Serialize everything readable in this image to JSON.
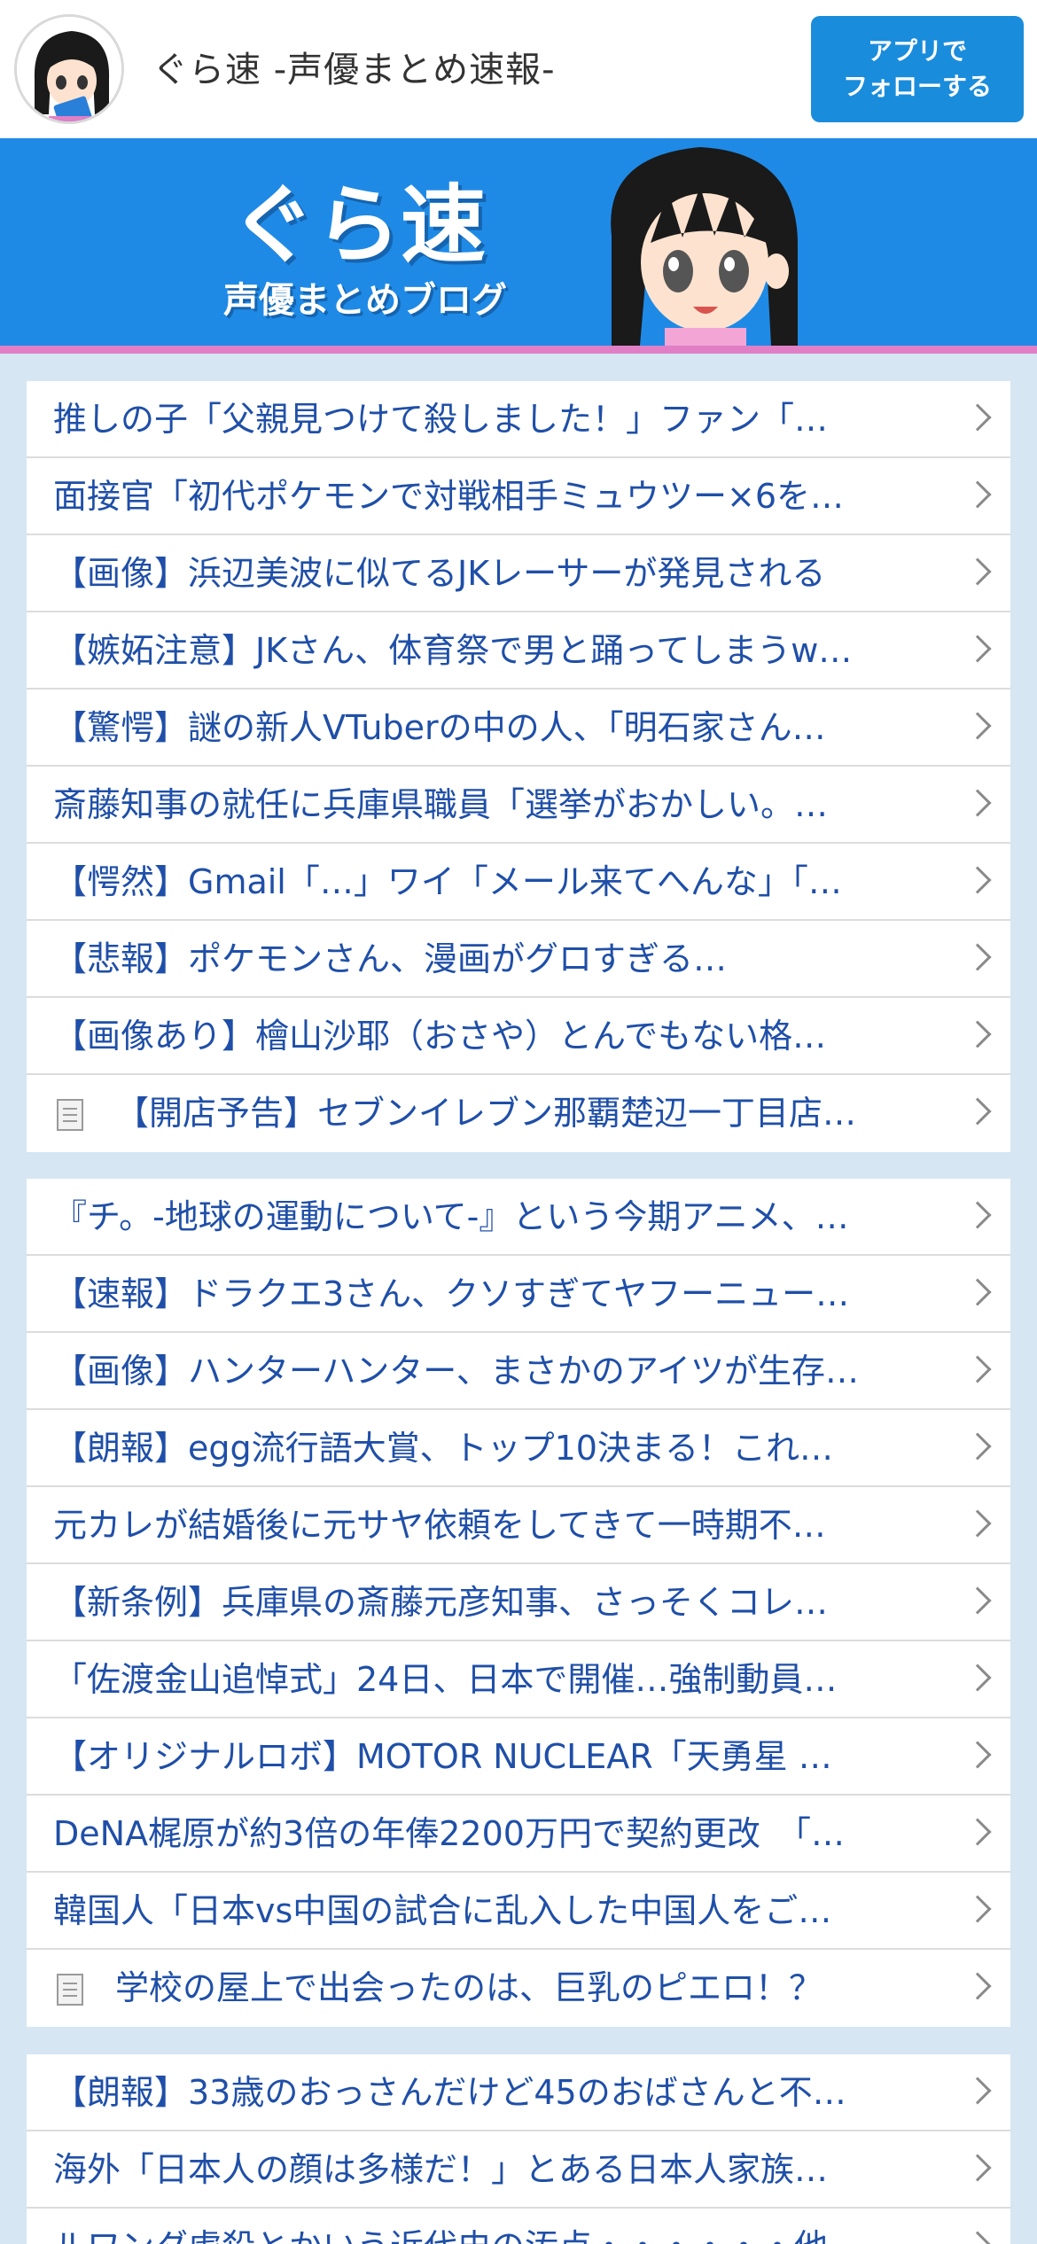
{
  "header": {
    "site_title": "ぐら速  -声優まとめ速報-",
    "follow_line1": "アプリで",
    "follow_line2": "フォローする"
  },
  "banner": {
    "logo_main": "ぐら速",
    "logo_sub": "声優まとめブログ"
  },
  "lists": [
    {
      "items": [
        {
          "text": "推しの子「父親見つけて殺しました！」ファン「…",
          "doc": false
        },
        {
          "text": "面接官「初代ポケモンで対戦相手ミュウツー×6を…",
          "doc": false
        },
        {
          "text": "【画像】浜辺美波に似てるJKレーサーが発見される",
          "doc": false
        },
        {
          "text": "【嫉妬注意】JKさん、体育祭で男と踊ってしまうw…",
          "doc": false
        },
        {
          "text": "【驚愕】謎の新人VTuberの中の人、「明石家さん…",
          "doc": false
        },
        {
          "text": "斎藤知事の就任に兵庫県職員「選挙がおかしい。…",
          "doc": false
        },
        {
          "text": "【愕然】Gmail「…」ワイ「メール来てへんな」「…",
          "doc": false
        },
        {
          "text": "【悲報】ポケモンさん、漫画がグロすぎる…",
          "doc": false
        },
        {
          "text": "【画像あり】檜山沙耶（おさや）とんでもない格…",
          "doc": false
        },
        {
          "text": "【開店予告】セブンイレブン那覇楚辺一丁目店…",
          "doc": true
        }
      ]
    },
    {
      "items": [
        {
          "text": "『チ。-地球の運動について-』という今期アニメ、…",
          "doc": false
        },
        {
          "text": "【速報】ドラクエ3さん、クソすぎてヤフーニュー…",
          "doc": false
        },
        {
          "text": "【画像】ハンターハンター、まさかのアイツが生存…",
          "doc": false
        },
        {
          "text": "【朗報】egg流行語大賞、トップ10決まる！これ…",
          "doc": false
        },
        {
          "text": "元カレが結婚後に元サヤ依頼をしてきて一時期不…",
          "doc": false
        },
        {
          "text": "【新条例】兵庫県の斎藤元彦知事、さっそくコレ…",
          "doc": false
        },
        {
          "text": "「佐渡金山追悼式」24日、日本で開催…強制動員…",
          "doc": false
        },
        {
          "text": "【オリジナルロボ】MOTOR NUCLEAR「天勇星 …",
          "doc": false
        },
        {
          "text": "DeNA梶原が約3倍の年俸2200万円で契約更改　「…",
          "doc": false
        },
        {
          "text": "韓国人「日本vs中国の試合に乱入した中国人をご…",
          "doc": false
        },
        {
          "text": "学校の屋上で出会ったのは、巨乳のピエロ！？",
          "doc": true
        }
      ]
    },
    {
      "items": [
        {
          "text": "【朗報】33歳のおっさんだけど45のおばさんと不…",
          "doc": false
        },
        {
          "text": "海外「日本人の顔は多様だ！」とある日本人家族…",
          "doc": false
        },
        {
          "text": "ルワンダ虐殺とかいう近代史の汚点・・・・・・他…",
          "doc": false
        }
      ]
    }
  ],
  "colors": {
    "link": "#1f4fa8",
    "banner": "#1f8ae6",
    "button": "#1a8cdc",
    "page_bg": "#d6e6f2"
  }
}
